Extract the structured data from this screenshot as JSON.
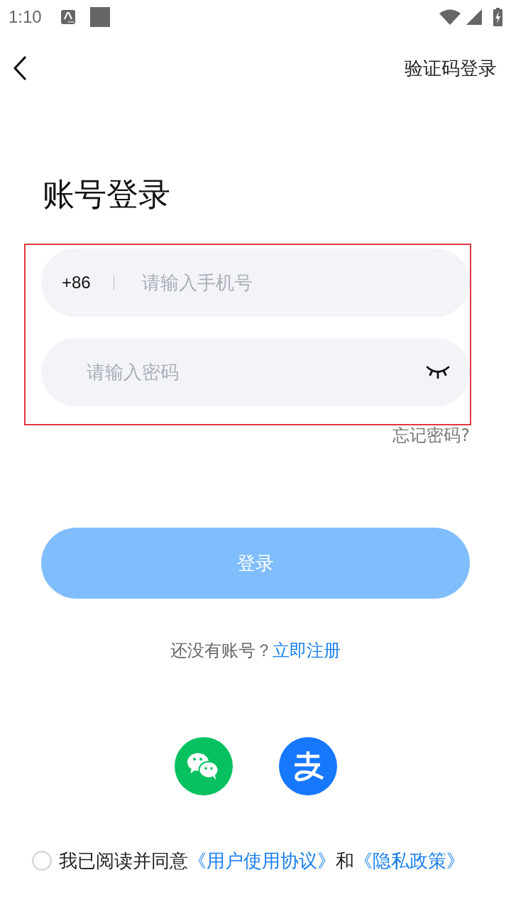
{
  "status_bar": {
    "time": "1:10"
  },
  "nav": {
    "right_action": "验证码登录"
  },
  "title": "账号登录",
  "login_form": {
    "highlighted": true,
    "phone_field": {
      "country_code": "+86",
      "placeholder": "请输入手机号"
    },
    "password_field": {
      "placeholder": "请输入密码",
      "revealed": false
    }
  },
  "forgot_password": "忘记密码?",
  "login_button": {
    "label": "登录",
    "disabled": true
  },
  "register_prompt": {
    "parts": [
      {
        "kind": "text",
        "text": "还没有账号？"
      },
      {
        "kind": "link",
        "text": "立即注册"
      }
    ]
  },
  "social_logins": [
    {
      "kind": "wechat"
    },
    {
      "kind": "alipay"
    }
  ],
  "agreement": {
    "checked": false,
    "parts": [
      {
        "kind": "text",
        "text": "我已阅读并同意"
      },
      {
        "kind": "link",
        "text": "《用户使用协议》"
      },
      {
        "kind": "text",
        "text": "和"
      },
      {
        "kind": "link",
        "text": "《隐私政策》"
      }
    ]
  }
}
